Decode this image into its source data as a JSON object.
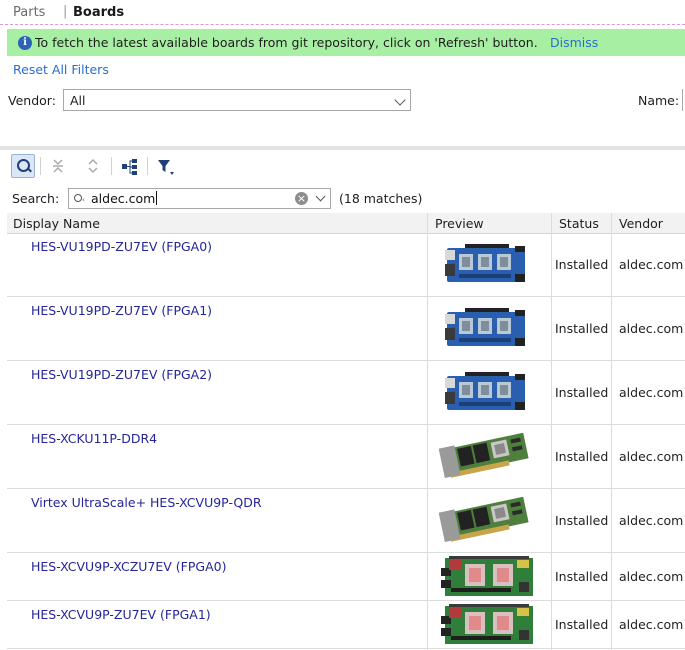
{
  "tabs": {
    "parts": "Parts",
    "separator": "|",
    "boards": "Boards"
  },
  "banner": {
    "icon": "info-icon",
    "message": "To fetch the latest available boards from git repository, click on 'Refresh' button.",
    "dismiss": "Dismiss",
    "color": "#a7f0a3"
  },
  "filters": {
    "reset_label": "Reset All Filters",
    "vendor_label": "Vendor:",
    "vendor_value": "All",
    "name_label": "Name:"
  },
  "toolbar": {
    "search_icon": "search-icon",
    "collapse_icon": "collapse-all-icon",
    "expand_icon": "expand-all-icon",
    "hierarchy_icon": "hierarchy-icon",
    "filter_icon": "filter-icon"
  },
  "search": {
    "label": "Search:",
    "value": "aldec.com",
    "matches": "(18 matches)"
  },
  "table": {
    "columns": [
      "Display Name",
      "Preview",
      "Status",
      "Vendor"
    ],
    "rows": [
      {
        "name": "HES-VU19PD-ZU7EV (FPGA0)",
        "preview": "blue-board",
        "status": "Installed",
        "vendor": "aldec.com"
      },
      {
        "name": "HES-VU19PD-ZU7EV (FPGA1)",
        "preview": "blue-board",
        "status": "Installed",
        "vendor": "aldec.com"
      },
      {
        "name": "HES-VU19PD-ZU7EV (FPGA2)",
        "preview": "blue-board",
        "status": "Installed",
        "vendor": "aldec.com"
      },
      {
        "name": "HES-XCKU11P-DDR4",
        "preview": "pcie-card",
        "status": "Installed",
        "vendor": "aldec.com"
      },
      {
        "name": "Virtex UltraScale+ HES-XCVU9P-QDR",
        "preview": "pcie-card",
        "status": "Installed",
        "vendor": "aldec.com"
      },
      {
        "name": "HES-XCVU9P-XCZU7EV (FPGA0)",
        "preview": "green-board",
        "status": "Installed",
        "vendor": "aldec.com"
      },
      {
        "name": "HES-XCVU9P-ZU7EV (FPGA1)",
        "preview": "green-board",
        "status": "Installed",
        "vendor": "aldec.com"
      }
    ]
  }
}
